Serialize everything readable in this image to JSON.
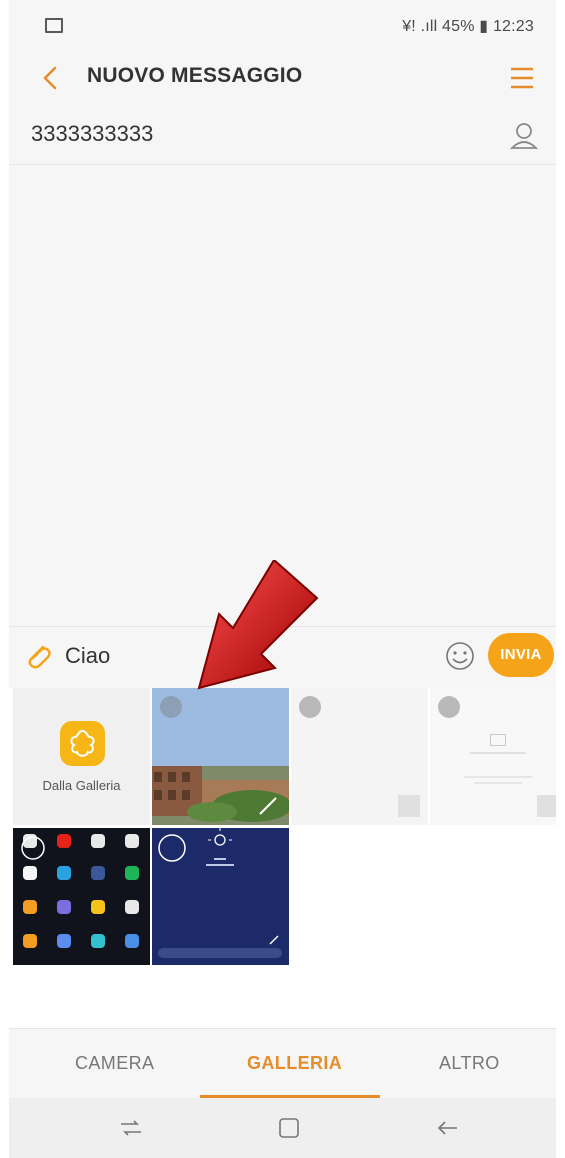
{
  "status_bar": {
    "right_text": "¥! .ıll 45% ▮ 12:23"
  },
  "app_bar": {
    "title": "NUOVO MESSAGGIO"
  },
  "recipient": {
    "number": "3333333333"
  },
  "composer": {
    "message": "Ciao",
    "send_label": "INVIA"
  },
  "gallery": {
    "from_gallery_label": "Dalla Galleria"
  },
  "tabs": [
    {
      "label": "CAMERA"
    },
    {
      "label": "GALLERIA"
    },
    {
      "label": "ALTRO"
    }
  ],
  "colors": {
    "accent": "#f5a318",
    "tab_active": "#e58d2c",
    "arrow": "#d10000"
  },
  "icons": {
    "back": "chevron-left-icon",
    "menu": "menu-icon",
    "contact": "contact-icon",
    "attach": "paperclip-icon",
    "emoji": "emoji-icon",
    "nav_recent": "recent-apps-icon",
    "nav_home": "home-icon",
    "nav_back": "back-icon"
  }
}
